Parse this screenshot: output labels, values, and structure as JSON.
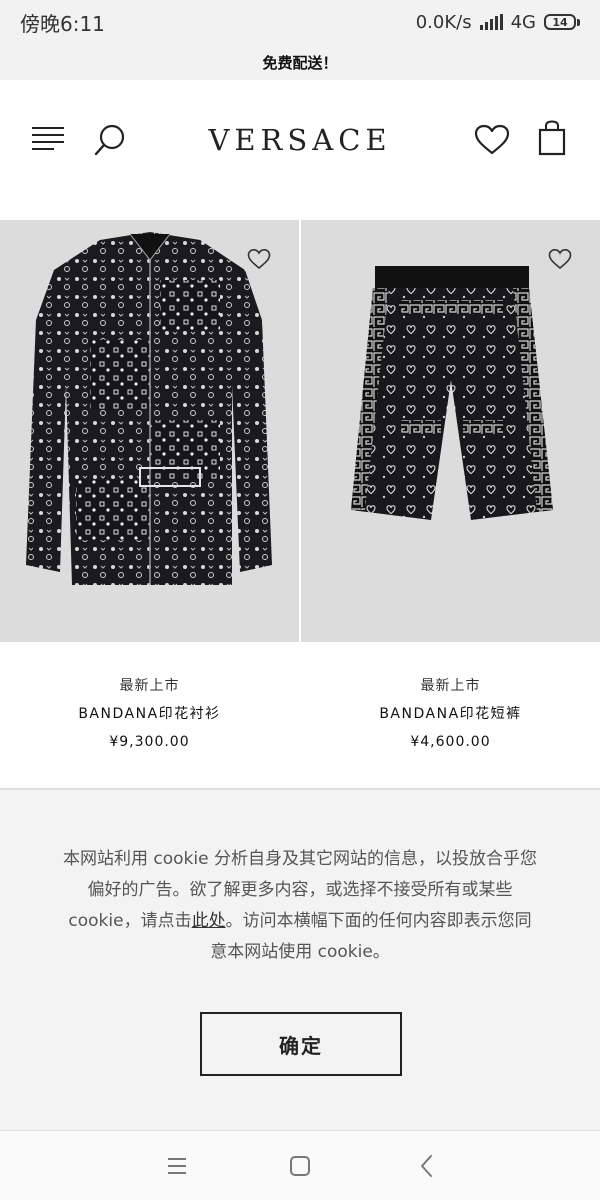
{
  "status_bar": {
    "time": "傍晚6:11",
    "network_speed": "0.0K/s",
    "network_type": "4G",
    "battery": "14"
  },
  "promo": {
    "text": "免费配送！"
  },
  "header": {
    "logo": "VERSACE",
    "icons": [
      "menu-icon",
      "search-icon",
      "heart-icon",
      "shopping-bag-icon"
    ]
  },
  "products": [
    {
      "tag": "最新上市",
      "name": "BANDANA印花衬衫",
      "price": "¥9,300.00",
      "image": "black-bandana-print-shirt"
    },
    {
      "tag": "最新上市",
      "name": "BANDANA印花短裤",
      "price": "¥4,600.00",
      "image": "black-bandana-print-shorts"
    }
  ],
  "cookie_banner": {
    "text_part1": "本网站利用 cookie 分析自身及其它网站的信息，以投放合乎您偏好的广告。欲了解更多内容，或选择不接受所有或某些 cookie，请点击",
    "link_text": "此处",
    "text_part2": "。访问本横幅下面的任何内容即表示您同意本网站使用 cookie。",
    "confirm_label": "确定"
  },
  "nav_bar": {
    "icons": [
      "menu-lines-icon",
      "home-square-icon",
      "back-chevron-icon"
    ]
  },
  "colors": {
    "background": "#ffffff",
    "banner_bg": "#f3f3f3",
    "text": "#222222",
    "image_bg": "#dcdcdc"
  }
}
